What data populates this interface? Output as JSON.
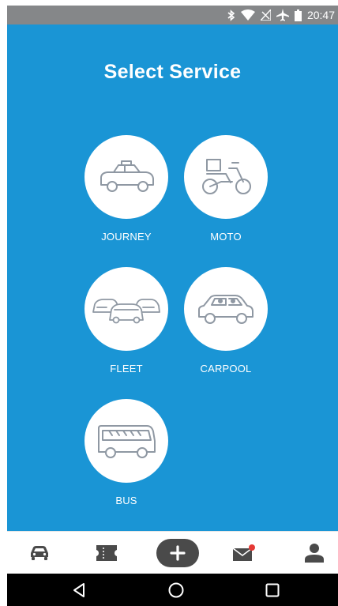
{
  "status_bar": {
    "time": "20:47",
    "icons": [
      "bluetooth-icon",
      "wifi-icon",
      "no-signal-icon",
      "airplane-icon",
      "battery-icon"
    ]
  },
  "page": {
    "title": "Select Service"
  },
  "services": [
    {
      "label": "JOURNEY",
      "icon": "taxi-car-icon"
    },
    {
      "label": "MOTO",
      "icon": "delivery-moto-icon"
    },
    {
      "label": "FLEET",
      "icon": "fleet-cars-icon"
    },
    {
      "label": "CARPOOL",
      "icon": "carpool-car-icon"
    },
    {
      "label": "BUS",
      "icon": "bus-icon"
    }
  ],
  "bottom_nav": {
    "items": [
      "car-icon",
      "ticket-icon",
      "add-icon",
      "mail-icon",
      "profile-icon"
    ],
    "mail_has_notification": true
  },
  "android_nav": {
    "items": [
      "back-icon",
      "home-icon",
      "recents-icon"
    ]
  },
  "colors": {
    "background": "#1a95d5",
    "status_bar": "#858789",
    "icon_line": "#8f98a3",
    "nav_icon": "#4a4a4a",
    "notification": "#e53935"
  }
}
